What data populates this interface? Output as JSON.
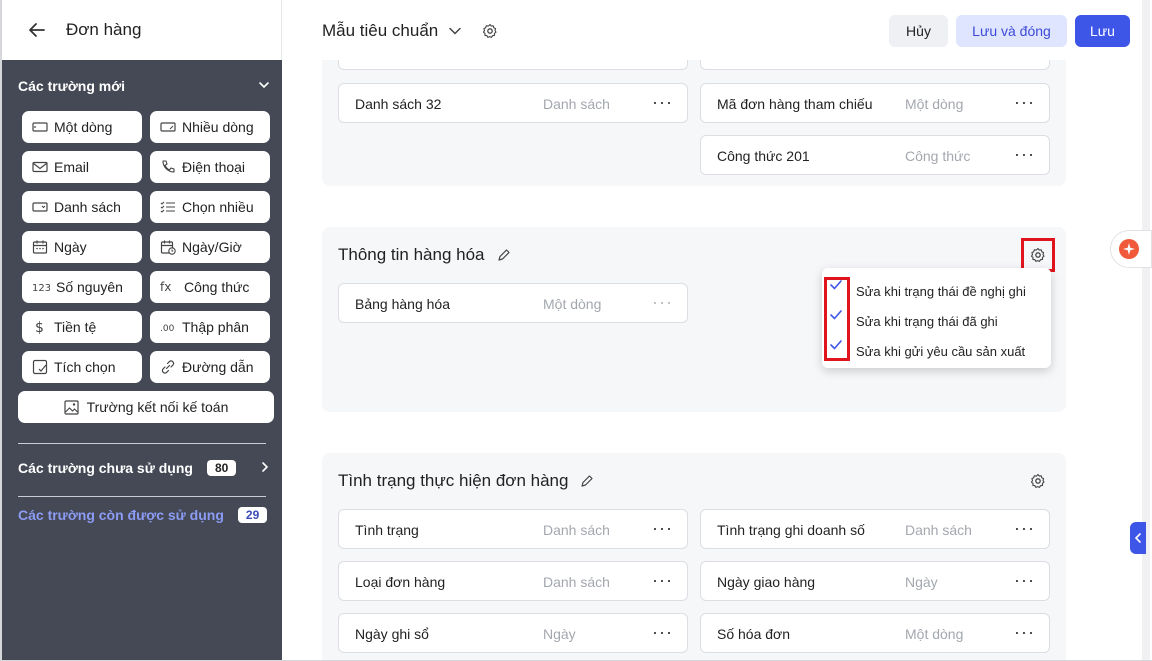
{
  "header": {
    "back_icon": "arrow-left-icon",
    "title": "Đơn hàng"
  },
  "toolbar": {
    "template_name": "Mẫu tiêu chuẩn",
    "cancel_label": "Hủy",
    "save_close_label": "Lưu và đóng",
    "save_label": "Lưu"
  },
  "sidebar": {
    "new_fields_title": "Các trường mới",
    "fields": [
      {
        "label": "Một dòng",
        "icon": "single-line-icon"
      },
      {
        "label": "Nhiều dòng",
        "icon": "multi-line-icon"
      },
      {
        "label": "Email",
        "icon": "email-icon"
      },
      {
        "label": "Điện thoại",
        "icon": "phone-icon"
      },
      {
        "label": "Danh sách",
        "icon": "dropdown-icon"
      },
      {
        "label": "Chọn nhiều",
        "icon": "multi-select-icon"
      },
      {
        "label": "Ngày",
        "icon": "calendar-icon"
      },
      {
        "label": "Ngày/Giờ",
        "icon": "calendar-clock-icon"
      },
      {
        "label": "Số nguyên",
        "icon": "number-icon"
      },
      {
        "label": "Công thức",
        "icon": "formula-icon"
      },
      {
        "label": "Tiền tệ",
        "icon": "currency-icon"
      },
      {
        "label": "Thập phân",
        "icon": "decimal-icon"
      },
      {
        "label": "Tích chọn",
        "icon": "checkbox-icon"
      },
      {
        "label": "Đường dẫn",
        "icon": "link-icon"
      }
    ],
    "accounting_field": "Trường kết nối kế toán",
    "unused_label": "Các trường chưa sử dụng",
    "unused_count": "80",
    "available_label": "Các trường còn được sử dụng",
    "available_count": "29"
  },
  "cards": {
    "top": {
      "fields": [
        {
          "name": "Danh sách 32",
          "type": "Danh sách"
        },
        {
          "name": "Mã đơn hàng tham chiếu",
          "type": "Một dòng"
        },
        {
          "name": "Công thức 201",
          "type": "Công thức"
        }
      ]
    },
    "goods": {
      "title": "Thông tin hàng hóa",
      "fields": [
        {
          "name": "Bảng hàng hóa",
          "type": "Một dòng"
        }
      ],
      "popup": [
        "Sửa khi trạng thái đề nghị ghi",
        "Sửa khi trạng thái đã ghi",
        "Sửa khi gửi yêu cầu sản xuất"
      ]
    },
    "status": {
      "title": "Tình trạng thực hiện đơn hàng",
      "fields": [
        {
          "name": "Tình trạng",
          "type": "Danh sách"
        },
        {
          "name": "Tình trạng ghi doanh số",
          "type": "Danh sách"
        },
        {
          "name": "Loại đơn hàng",
          "type": "Danh sách"
        },
        {
          "name": "Ngày giao hàng",
          "type": "Ngày"
        },
        {
          "name": "Ngày ghi sổ",
          "type": "Ngày"
        },
        {
          "name": "Số hóa đơn",
          "type": "Một dòng"
        }
      ]
    }
  },
  "dots": "···",
  "colors": {
    "sidebar_bg": "#444955",
    "primary": "#3e56e8",
    "highlight": "#e0141c"
  }
}
